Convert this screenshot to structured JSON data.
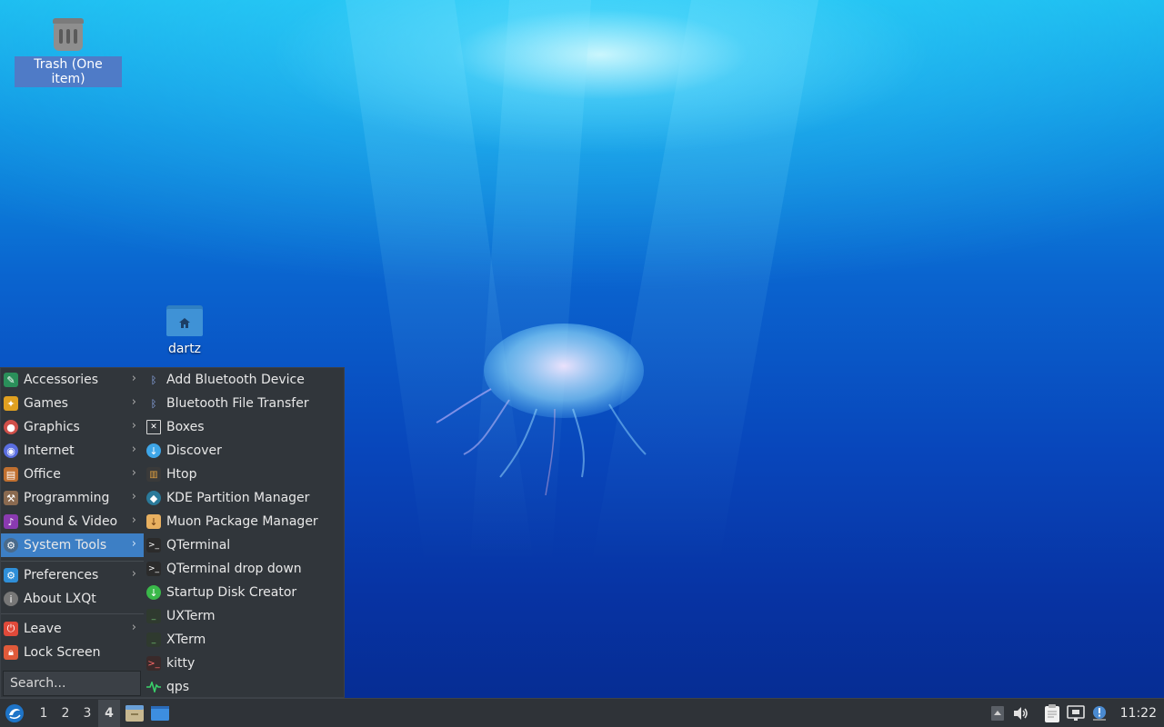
{
  "desktop": {
    "trash_label": "Trash (One item)",
    "home_label": "dartz"
  },
  "menu": {
    "categories": [
      {
        "label": "Accessories",
        "icon": "accessories-icon",
        "color": "#2a8f5a",
        "has_submenu": true
      },
      {
        "label": "Games",
        "icon": "games-icon",
        "color": "#e0a020",
        "has_submenu": true
      },
      {
        "label": "Graphics",
        "icon": "graphics-icon",
        "color": "#d0504a",
        "has_submenu": true
      },
      {
        "label": "Internet",
        "icon": "internet-icon",
        "color": "#5a6ee0",
        "has_submenu": true
      },
      {
        "label": "Office",
        "icon": "office-icon",
        "color": "#c07030",
        "has_submenu": true
      },
      {
        "label": "Programming",
        "icon": "programming-icon",
        "color": "#8a6a50",
        "has_submenu": true
      },
      {
        "label": "Sound & Video",
        "icon": "sound-video-icon",
        "color": "#8a3ab0",
        "has_submenu": true
      },
      {
        "label": "System Tools",
        "icon": "system-tools-icon",
        "color": "#4a6a8a",
        "has_submenu": true,
        "active": true
      }
    ],
    "preferences": {
      "label": "Preferences",
      "icon": "preferences-icon",
      "color": "#2f8fd8"
    },
    "about": {
      "label": "About LXQt",
      "icon": "about-icon",
      "color": "#777777"
    },
    "leave": {
      "label": "Leave",
      "icon": "power-icon",
      "color": "#e04a3a"
    },
    "lock": {
      "label": "Lock Screen",
      "icon": "lock-icon",
      "color": "#e05a3a"
    },
    "search_placeholder": "Search...",
    "system_tools": [
      {
        "label": "Add Bluetooth Device",
        "icon": "bluetooth-icon"
      },
      {
        "label": "Bluetooth File Transfer",
        "icon": "bluetooth-icon"
      },
      {
        "label": "Boxes",
        "icon": "boxes-icon"
      },
      {
        "label": "Discover",
        "icon": "discover-icon"
      },
      {
        "label": "Htop",
        "icon": "htop-icon"
      },
      {
        "label": "KDE Partition Manager",
        "icon": "partition-manager-icon"
      },
      {
        "label": "Muon Package Manager",
        "icon": "muon-icon"
      },
      {
        "label": "QTerminal",
        "icon": "terminal-icon"
      },
      {
        "label": "QTerminal drop down",
        "icon": "terminal-icon"
      },
      {
        "label": "Startup Disk Creator",
        "icon": "startup-disk-icon"
      },
      {
        "label": "UXTerm",
        "icon": "xterm-icon"
      },
      {
        "label": "XTerm",
        "icon": "xterm-icon"
      },
      {
        "label": "kitty",
        "icon": "kitty-icon"
      },
      {
        "label": "qps",
        "icon": "qps-icon"
      }
    ]
  },
  "taskbar": {
    "workspaces": [
      "1",
      "2",
      "3",
      "4"
    ],
    "current_workspace": "4",
    "clock": "11:22"
  }
}
